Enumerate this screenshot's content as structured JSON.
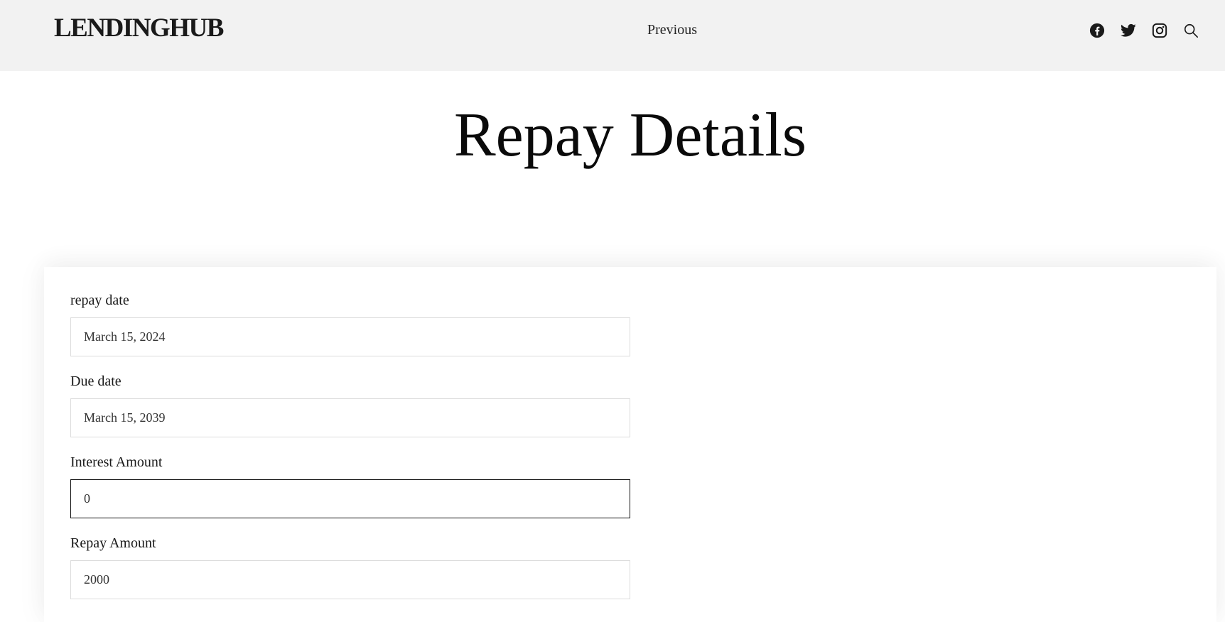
{
  "header": {
    "logo": "LENDINGHUB",
    "nav_previous": "Previous",
    "icons": [
      "facebook-icon",
      "twitter-icon",
      "instagram-icon",
      "search-icon"
    ]
  },
  "page": {
    "title": "Repay Details"
  },
  "form": {
    "repay_date": {
      "label": "repay date",
      "value": "March 15, 2024"
    },
    "due_date": {
      "label": "Due date",
      "value": "March 15, 2039"
    },
    "interest_amount": {
      "label": "Interest Amount",
      "value": "0"
    },
    "repay_amount": {
      "label": "Repay Amount",
      "value": "2000"
    }
  },
  "colors": {
    "header_bg": "#f2f2f2",
    "page_bg": "#ffffff",
    "focused_border": "#111111",
    "input_border": "#dcdcdc"
  }
}
